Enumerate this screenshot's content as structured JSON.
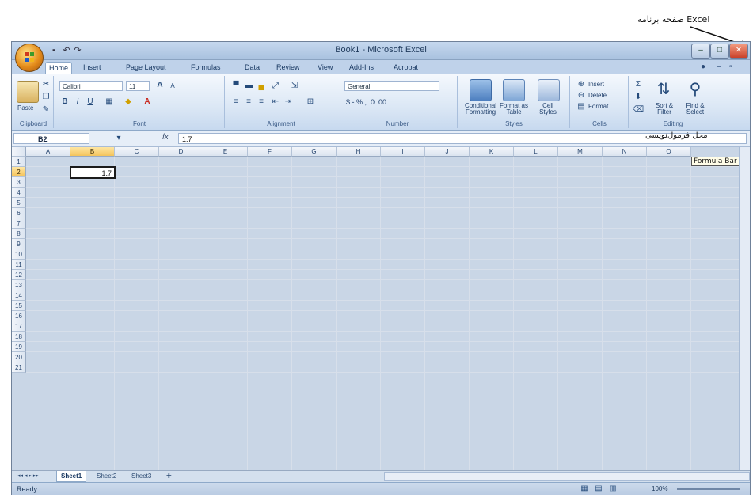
{
  "annotations": {
    "top": "صفحه برنامه Excel",
    "formula": "محل فرمول‌نویسی",
    "formula_tooltip": "Formula Bar"
  },
  "window": {
    "title": "Book1 - Microsoft Excel",
    "min_label": "–",
    "max_label": "□",
    "close_label": "✕"
  },
  "tabs": [
    "Home",
    "Insert",
    "Page Layout",
    "Formulas",
    "Data",
    "Review",
    "View",
    "Add-Ins",
    "Acrobat"
  ],
  "active_tab": "Home",
  "ribbon": {
    "clipboard": {
      "label": "Clipboard",
      "paste": "Paste"
    },
    "font": {
      "label": "Font",
      "name": "Calibri",
      "size": "11"
    },
    "alignment": {
      "label": "Alignment"
    },
    "number": {
      "label": "Number",
      "format": "General",
      "buttons": "$ - % , .0 .00"
    },
    "styles": {
      "label": "Styles",
      "cf": "Conditional Formatting",
      "fat": "Format as Table",
      "cs": "Cell Styles"
    },
    "cells": {
      "label": "Cells",
      "insert": "Insert",
      "delete": "Delete",
      "format": "Format"
    },
    "editing": {
      "label": "Editing",
      "sort": "Sort & Filter",
      "find": "Find & Select"
    }
  },
  "formula_bar": {
    "name_box": "B2",
    "fx": "fx",
    "value": "1.7"
  },
  "columns": [
    "A",
    "B",
    "C",
    "D",
    "E",
    "F",
    "G",
    "H",
    "I",
    "J",
    "K",
    "L",
    "M",
    "N",
    "O"
  ],
  "selected_column": "B",
  "rows": [
    "1",
    "2",
    "3",
    "4",
    "5",
    "6",
    "7",
    "8",
    "9",
    "10",
    "11",
    "12",
    "13",
    "14",
    "15",
    "16",
    "17",
    "18",
    "19",
    "20",
    "21"
  ],
  "selected_row": "2",
  "cell_B2": "1.7",
  "sheets": [
    "Sheet1",
    "Sheet2",
    "Sheet3"
  ],
  "active_sheet": "Sheet1",
  "status": {
    "ready": "Ready",
    "zoom": "100%"
  },
  "colors": {
    "accent": "#f4c35a",
    "window_frame": "#6f8199",
    "ribbon": "#dbe7f5"
  }
}
